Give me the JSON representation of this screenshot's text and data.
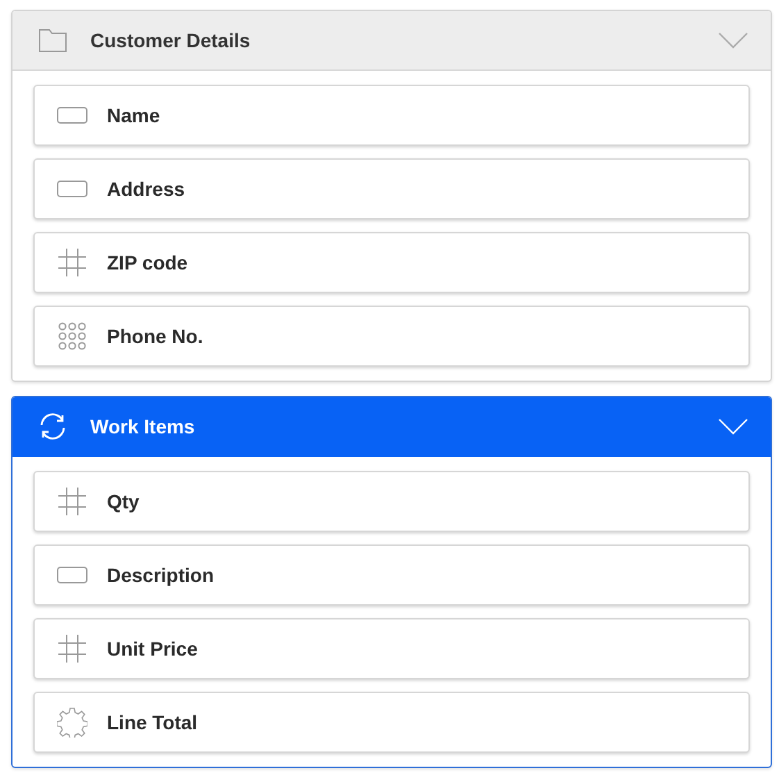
{
  "sections": [
    {
      "title": "Customer Details",
      "kind": "folder",
      "selected": false,
      "fields": [
        {
          "label": "Name",
          "kind": "text"
        },
        {
          "label": "Address",
          "kind": "text"
        },
        {
          "label": "ZIP code",
          "kind": "number"
        },
        {
          "label": "Phone No.",
          "kind": "phone"
        }
      ]
    },
    {
      "title": "Work Items",
      "kind": "sync",
      "selected": true,
      "fields": [
        {
          "label": "Qty",
          "kind": "number"
        },
        {
          "label": "Description",
          "kind": "text"
        },
        {
          "label": "Unit Price",
          "kind": "number"
        },
        {
          "label": "Line Total",
          "kind": "formula"
        }
      ]
    }
  ]
}
